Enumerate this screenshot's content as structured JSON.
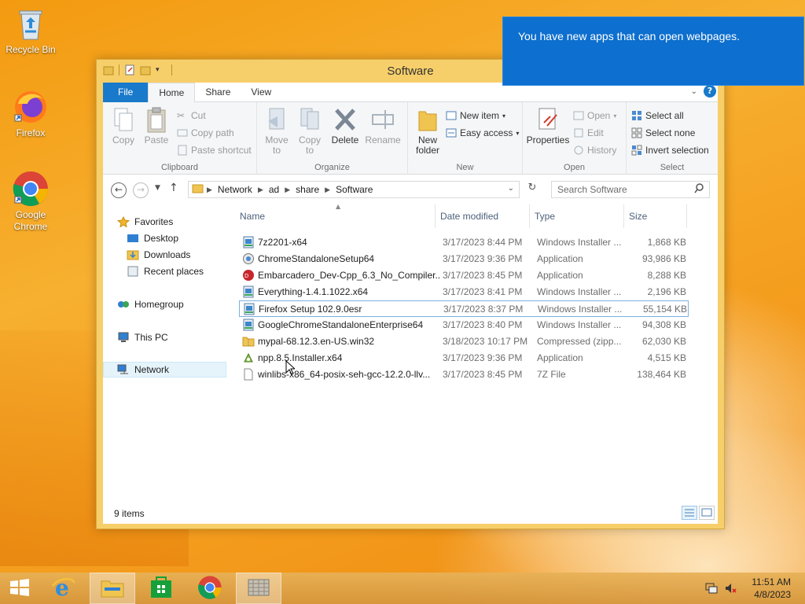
{
  "desktop": {
    "icons": [
      {
        "label": "Recycle Bin",
        "icon": "recycle-bin-icon"
      },
      {
        "label": "Firefox",
        "icon": "firefox-icon"
      },
      {
        "label": "Google Chrome",
        "icon": "chrome-icon"
      }
    ]
  },
  "notification": {
    "text": "You have new apps that can open webpages."
  },
  "window": {
    "title": "Software",
    "tabs": [
      {
        "label": "File"
      },
      {
        "label": "Home"
      },
      {
        "label": "Share"
      },
      {
        "label": "View"
      }
    ],
    "help": "?",
    "ribbon": {
      "clipboard": {
        "label": "Clipboard",
        "copy": "Copy",
        "paste": "Paste",
        "cut": "Cut",
        "copy_path": "Copy path",
        "paste_shortcut": "Paste shortcut"
      },
      "organize": {
        "label": "Organize",
        "move_to": "Move to",
        "copy_to": "Copy to",
        "delete": "Delete",
        "rename": "Rename"
      },
      "new": {
        "label": "New",
        "new_folder": "New folder",
        "new_item": "New item",
        "easy_access": "Easy access"
      },
      "open": {
        "label": "Open",
        "properties": "Properties",
        "open": "Open",
        "edit": "Edit",
        "history": "History"
      },
      "select": {
        "label": "Select",
        "select_all": "Select all",
        "select_none": "Select none",
        "invert_selection": "Invert selection"
      }
    },
    "address": {
      "crumbs": [
        "Network",
        "ad",
        "share",
        "Software"
      ],
      "search_placeholder": "Search Software"
    },
    "nav": {
      "favorites": "Favorites",
      "desktop": "Desktop",
      "downloads": "Downloads",
      "recent": "Recent places",
      "homegroup": "Homegroup",
      "this_pc": "This PC",
      "network": "Network"
    },
    "columns": {
      "name": "Name",
      "date": "Date modified",
      "type": "Type",
      "size": "Size"
    },
    "files": [
      {
        "name": "7z2201-x64",
        "date": "3/17/2023 8:44 PM",
        "type": "Windows Installer ...",
        "size": "1,868 KB",
        "icon": "msi-icon"
      },
      {
        "name": "ChromeStandaloneSetup64",
        "date": "3/17/2023 9:36 PM",
        "type": "Application",
        "size": "93,986 KB",
        "icon": "app-icon"
      },
      {
        "name": "Embarcadero_Dev-Cpp_6.3_No_Compiler...",
        "date": "3/17/2023 8:45 PM",
        "type": "Application",
        "size": "8,288 KB",
        "icon": "devcpp-icon"
      },
      {
        "name": "Everything-1.4.1.1022.x64",
        "date": "3/17/2023 8:41 PM",
        "type": "Windows Installer ...",
        "size": "2,196 KB",
        "icon": "msi-icon"
      },
      {
        "name": "Firefox Setup 102.9.0esr",
        "date": "3/17/2023 8:37 PM",
        "type": "Windows Installer ...",
        "size": "55,154 KB",
        "icon": "msi-icon"
      },
      {
        "name": "GoogleChromeStandaloneEnterprise64",
        "date": "3/17/2023 8:40 PM",
        "type": "Windows Installer ...",
        "size": "94,308 KB",
        "icon": "msi-icon"
      },
      {
        "name": "mypal-68.12.3.en-US.win32",
        "date": "3/18/2023 10:17 PM",
        "type": "Compressed (zipp...",
        "size": "62,030 KB",
        "icon": "zip-folder-icon"
      },
      {
        "name": "npp.8.5.Installer.x64",
        "date": "3/17/2023 9:36 PM",
        "type": "Application",
        "size": "4,515 KB",
        "icon": "npp-icon"
      },
      {
        "name": "winlibs-x86_64-posix-seh-gcc-12.2.0-llv...",
        "date": "3/17/2023 8:45 PM",
        "type": "7Z File",
        "size": "138,464 KB",
        "icon": "file-icon"
      }
    ],
    "status": "9 items"
  },
  "taskbar": {
    "clock_time": "11:51 AM",
    "clock_date": "4/8/2023"
  }
}
